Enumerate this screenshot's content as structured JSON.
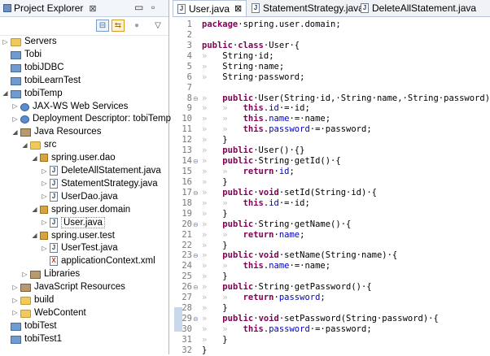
{
  "explorer": {
    "title": "Project Explorer",
    "close": "⊠",
    "minimize": "▭",
    "maximize": "▫",
    "items": [
      {
        "label": "Servers",
        "arrow": "▷",
        "icon": "folder",
        "indent": 0
      },
      {
        "label": "Tobi",
        "arrow": "",
        "icon": "project",
        "indent": 0
      },
      {
        "label": "tobiJDBC",
        "arrow": "",
        "icon": "project",
        "indent": 0
      },
      {
        "label": "tobiLearnTest",
        "arrow": "",
        "icon": "project",
        "indent": 0
      },
      {
        "label": "tobiTemp",
        "arrow": "◢",
        "icon": "project",
        "indent": 0
      },
      {
        "label": "JAX-WS Web Services",
        "arrow": "▷",
        "icon": "web",
        "indent": 1
      },
      {
        "label": "Deployment Descriptor: tobiTemp",
        "arrow": "▷",
        "icon": "web",
        "indent": 1
      },
      {
        "label": "Java Resources",
        "arrow": "◢",
        "icon": "library",
        "indent": 1
      },
      {
        "label": "src",
        "arrow": "◢",
        "icon": "folder",
        "indent": 2
      },
      {
        "label": "spring.user.dao",
        "arrow": "◢",
        "icon": "package",
        "indent": 3
      },
      {
        "label": "DeleteAllStatement.java",
        "arrow": "▷",
        "icon": "java",
        "indent": 4
      },
      {
        "label": "StatementStrategy.java",
        "arrow": "▷",
        "icon": "java",
        "indent": 4
      },
      {
        "label": "UserDao.java",
        "arrow": "▷",
        "icon": "java",
        "indent": 4
      },
      {
        "label": "spring.user.domain",
        "arrow": "◢",
        "icon": "package",
        "indent": 3
      },
      {
        "label": "User.java",
        "arrow": "▷",
        "icon": "java",
        "indent": 4,
        "selected": true
      },
      {
        "label": "spring.user.test",
        "arrow": "◢",
        "icon": "package",
        "indent": 3
      },
      {
        "label": "UserTest.java",
        "arrow": "▷",
        "icon": "java",
        "indent": 4
      },
      {
        "label": "applicationContext.xml",
        "arrow": "",
        "icon": "xml",
        "indent": 4
      },
      {
        "label": "Libraries",
        "arrow": "▷",
        "icon": "library",
        "indent": 2
      },
      {
        "label": "JavaScript Resources",
        "arrow": "▷",
        "icon": "library",
        "indent": 1
      },
      {
        "label": "build",
        "arrow": "▷",
        "icon": "folder",
        "indent": 1
      },
      {
        "label": "WebContent",
        "arrow": "▷",
        "icon": "folder",
        "indent": 1
      },
      {
        "label": "tobiTest",
        "arrow": "",
        "icon": "project",
        "indent": 0
      },
      {
        "label": "tobiTest1",
        "arrow": "",
        "icon": "project",
        "indent": 0
      }
    ]
  },
  "editor": {
    "tabs": [
      {
        "label": "User.java",
        "active": true,
        "close": "⊠"
      },
      {
        "label": "StatementStrategy.java",
        "active": false
      },
      {
        "label": "DeleteAllStatement.java",
        "active": false
      }
    ],
    "lines": [
      {
        "n": "1",
        "fold": "",
        "tokens": [
          [
            "kw",
            "package"
          ],
          [
            "",
            "·spring.user.domain;"
          ]
        ]
      },
      {
        "n": "2",
        "fold": "",
        "tokens": []
      },
      {
        "n": "3",
        "fold": "",
        "tokens": [
          [
            "kw",
            "public"
          ],
          [
            "",
            "·"
          ],
          [
            "kw",
            "class"
          ],
          [
            "",
            "·User·{"
          ]
        ]
      },
      {
        "n": "4",
        "fold": "",
        "tokens": [
          [
            "ws",
            "»   "
          ],
          [
            "",
            "String·id;"
          ]
        ]
      },
      {
        "n": "5",
        "fold": "",
        "tokens": [
          [
            "ws",
            "»   "
          ],
          [
            "",
            "String·name;"
          ]
        ]
      },
      {
        "n": "6",
        "fold": "",
        "tokens": [
          [
            "ws",
            "»   "
          ],
          [
            "",
            "String·password;"
          ]
        ]
      },
      {
        "n": "7",
        "fold": "",
        "tokens": []
      },
      {
        "n": "8",
        "fold": "⊖",
        "tokens": [
          [
            "ws",
            "»   "
          ],
          [
            "kw",
            "public"
          ],
          [
            "",
            "·User(String·id,·String·name,·String·password)·{"
          ]
        ]
      },
      {
        "n": "9",
        "fold": "",
        "tokens": [
          [
            "ws",
            "»   »   "
          ],
          [
            "kw",
            "this"
          ],
          [
            "",
            "."
          ],
          [
            "fld",
            "id"
          ],
          [
            "",
            "·=·id;"
          ]
        ]
      },
      {
        "n": "10",
        "fold": "",
        "tokens": [
          [
            "ws",
            "»   »   "
          ],
          [
            "kw",
            "this"
          ],
          [
            "",
            "."
          ],
          [
            "fld",
            "name"
          ],
          [
            "",
            "·=·name;"
          ]
        ]
      },
      {
        "n": "11",
        "fold": "",
        "tokens": [
          [
            "ws",
            "»   »   "
          ],
          [
            "kw",
            "this"
          ],
          [
            "",
            "."
          ],
          [
            "fld",
            "password"
          ],
          [
            "",
            "·=·password;"
          ]
        ]
      },
      {
        "n": "12",
        "fold": "",
        "tokens": [
          [
            "ws",
            "»   "
          ],
          [
            "",
            "}"
          ]
        ]
      },
      {
        "n": "13",
        "fold": "",
        "tokens": [
          [
            "ws",
            "»   "
          ],
          [
            "kw",
            "public"
          ],
          [
            "",
            "·User()·{}"
          ]
        ]
      },
      {
        "n": "14",
        "fold": "⊖",
        "tokens": [
          [
            "ws",
            "»   "
          ],
          [
            "kw",
            "public"
          ],
          [
            "",
            "·String·getId()·{"
          ]
        ]
      },
      {
        "n": "15",
        "fold": "",
        "tokens": [
          [
            "ws",
            "»   »   "
          ],
          [
            "kw",
            "return"
          ],
          [
            "",
            "·"
          ],
          [
            "fld",
            "id"
          ],
          [
            "",
            ";"
          ]
        ]
      },
      {
        "n": "16",
        "fold": "",
        "tokens": [
          [
            "ws",
            "»   "
          ],
          [
            "",
            "}"
          ]
        ]
      },
      {
        "n": "17",
        "fold": "⊖",
        "tokens": [
          [
            "ws",
            "»   "
          ],
          [
            "kw",
            "public"
          ],
          [
            "",
            "·"
          ],
          [
            "kw",
            "void"
          ],
          [
            "",
            "·setId(String·id)·{"
          ]
        ]
      },
      {
        "n": "18",
        "fold": "",
        "tokens": [
          [
            "ws",
            "»   »   "
          ],
          [
            "kw",
            "this"
          ],
          [
            "",
            "."
          ],
          [
            "fld",
            "id"
          ],
          [
            "",
            "·=·id;"
          ]
        ]
      },
      {
        "n": "19",
        "fold": "",
        "tokens": [
          [
            "ws",
            "»   "
          ],
          [
            "",
            "}"
          ]
        ]
      },
      {
        "n": "20",
        "fold": "⊖",
        "tokens": [
          [
            "ws",
            "»   "
          ],
          [
            "kw",
            "public"
          ],
          [
            "",
            "·String·getName()·{"
          ]
        ]
      },
      {
        "n": "21",
        "fold": "",
        "tokens": [
          [
            "ws",
            "»   »   "
          ],
          [
            "kw",
            "return"
          ],
          [
            "",
            "·"
          ],
          [
            "fld",
            "name"
          ],
          [
            "",
            ";"
          ]
        ]
      },
      {
        "n": "22",
        "fold": "",
        "tokens": [
          [
            "ws",
            "»   "
          ],
          [
            "",
            "}"
          ]
        ]
      },
      {
        "n": "23",
        "fold": "⊖",
        "tokens": [
          [
            "ws",
            "»   "
          ],
          [
            "kw",
            "public"
          ],
          [
            "",
            "·"
          ],
          [
            "kw",
            "void"
          ],
          [
            "",
            "·setName(String·name)·{"
          ]
        ]
      },
      {
        "n": "24",
        "fold": "",
        "tokens": [
          [
            "ws",
            "»   »   "
          ],
          [
            "kw",
            "this"
          ],
          [
            "",
            "."
          ],
          [
            "fld",
            "name"
          ],
          [
            "",
            "·=·name;"
          ]
        ]
      },
      {
        "n": "25",
        "fold": "",
        "tokens": [
          [
            "ws",
            "»   "
          ],
          [
            "",
            "}"
          ]
        ]
      },
      {
        "n": "26",
        "fold": "⊖",
        "tokens": [
          [
            "ws",
            "»   "
          ],
          [
            "kw",
            "public"
          ],
          [
            "",
            "·String·getPassword()·{"
          ]
        ]
      },
      {
        "n": "27",
        "fold": "",
        "tokens": [
          [
            "ws",
            "»   »   "
          ],
          [
            "kw",
            "return"
          ],
          [
            "",
            "·"
          ],
          [
            "fld",
            "password"
          ],
          [
            "",
            ";"
          ]
        ]
      },
      {
        "n": "28",
        "fold": "",
        "tokens": [
          [
            "ws",
            "»   "
          ],
          [
            "",
            "}"
          ]
        ]
      },
      {
        "n": "29",
        "fold": "⊖",
        "tokens": [
          [
            "ws",
            "»   "
          ],
          [
            "kw",
            "public"
          ],
          [
            "",
            "·"
          ],
          [
            "kw",
            "void"
          ],
          [
            "",
            "·setPassword(String·password)·{"
          ]
        ]
      },
      {
        "n": "30",
        "fold": "",
        "tokens": [
          [
            "ws",
            "»   »   "
          ],
          [
            "kw",
            "this"
          ],
          [
            "",
            "."
          ],
          [
            "fld",
            "password"
          ],
          [
            "",
            "·=·password;"
          ]
        ]
      },
      {
        "n": "31",
        "fold": "",
        "tokens": [
          [
            "ws",
            "»   "
          ],
          [
            "",
            "}"
          ]
        ]
      },
      {
        "n": "32",
        "fold": "",
        "tokens": [
          [
            "",
            "}"
          ]
        ]
      }
    ]
  }
}
